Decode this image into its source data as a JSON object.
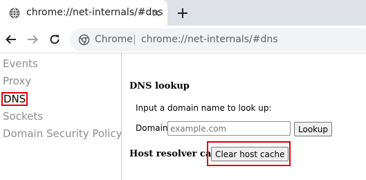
{
  "browser": {
    "tab_title": "chrome://net-internals/#dns",
    "omnibox_label": "Chrome",
    "omnibox_separator": "|",
    "omnibox_url": "chrome://net-internals/#dns"
  },
  "sidebar": {
    "items": [
      {
        "label": "Events"
      },
      {
        "label": "Proxy"
      },
      {
        "label": "DNS",
        "selected": true
      },
      {
        "label": "Sockets"
      },
      {
        "label": "Domain Security Policy"
      }
    ]
  },
  "main": {
    "dns_lookup_title": "DNS lookup",
    "instruction": "Input a domain name to look up:",
    "domain_label": "Domain:",
    "domain_placeholder": "example.com",
    "domain_value": "",
    "lookup_button": "Lookup",
    "host_resolver_label": "Host resolver cache",
    "clear_cache_button": "Clear host cache"
  },
  "colors": {
    "highlight_red": "#e00000",
    "tabstrip_bg": "#dee1e6",
    "sidebar_text": "#8e8e8e"
  }
}
